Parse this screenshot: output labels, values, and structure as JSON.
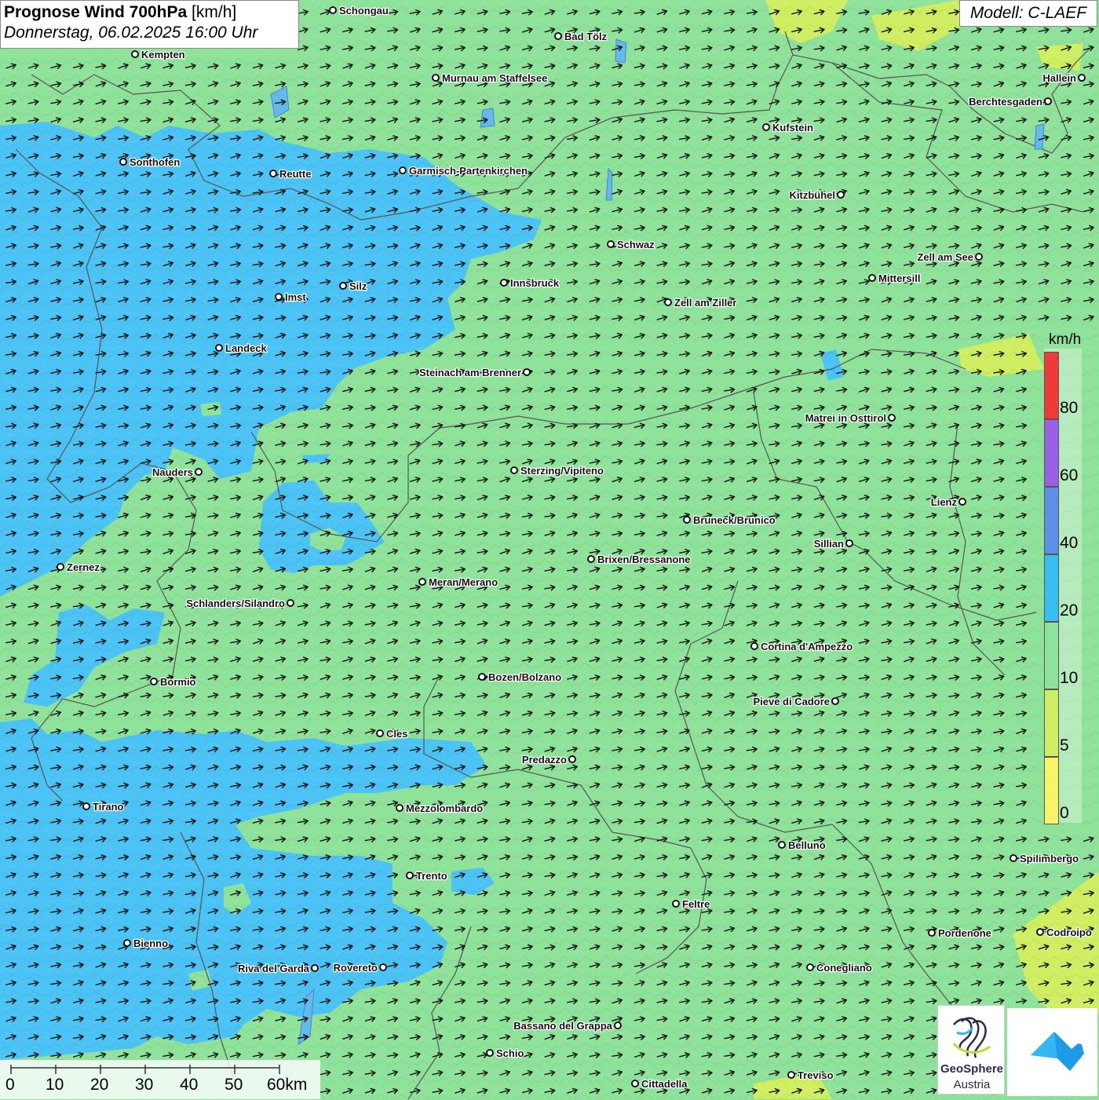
{
  "title": {
    "bold": "Prognose Wind 700hPa",
    "unit": " [km/h]",
    "date": "Donnerstag, 06.02.2025 16:00 Uhr"
  },
  "model": "Modell: C-LAEF",
  "legend": {
    "unit": "km/h",
    "labels": [
      "80",
      "60",
      "40",
      "20",
      "10",
      "5",
      "0"
    ],
    "colors": [
      "#f03a3a",
      "#9a60e6",
      "#5c8fe8",
      "#36bdf2",
      "#8fe29a",
      "#cfee62",
      "#f6f56a"
    ]
  },
  "scale": {
    "labels": [
      "0",
      "10",
      "20",
      "30",
      "40",
      "50",
      "60km"
    ]
  },
  "colors": {
    "calm_green": "#8fe29a",
    "light_blue": "#4cc3f5",
    "yellow_green": "#cfee62"
  },
  "cities": [
    {
      "name": "Schongau"
    },
    {
      "name": "Bad Tölz"
    },
    {
      "name": "Kempten"
    },
    {
      "name": "Murnau am Staffelsee"
    },
    {
      "name": "Hallein"
    },
    {
      "name": "Berchtesgaden"
    },
    {
      "name": "Kufstein"
    },
    {
      "name": "Sonthofen"
    },
    {
      "name": "Reutte"
    },
    {
      "name": "Garmisch-Partenkirchen"
    },
    {
      "name": "Kitzbühel"
    },
    {
      "name": "Schwaz"
    },
    {
      "name": "Zell am See"
    },
    {
      "name": "Mittersill"
    },
    {
      "name": "Innsbruck"
    },
    {
      "name": "Silz"
    },
    {
      "name": "Imst"
    },
    {
      "name": "Zell am Ziller"
    },
    {
      "name": "Landeck"
    },
    {
      "name": "Steinach am Brenner"
    },
    {
      "name": "Matrei in Osttirol"
    },
    {
      "name": "Nauders"
    },
    {
      "name": "Sterzing/Vipiteno"
    },
    {
      "name": "Lienz"
    },
    {
      "name": "Bruneck/Brunico"
    },
    {
      "name": "Sillian"
    },
    {
      "name": "Brixen/Bressanone"
    },
    {
      "name": "Zernez"
    },
    {
      "name": "Meran/Merano"
    },
    {
      "name": "Schlanders/Silandro"
    },
    {
      "name": "Cortina d'Ampezzo"
    },
    {
      "name": "Bozen/Bolzano"
    },
    {
      "name": "Bormio"
    },
    {
      "name": "Pieve di Cadore"
    },
    {
      "name": "Cles"
    },
    {
      "name": "Predazzo"
    },
    {
      "name": "Tirano"
    },
    {
      "name": "Mezzolombardo"
    },
    {
      "name": "Belluno"
    },
    {
      "name": "Spilimbergo"
    },
    {
      "name": "Trento"
    },
    {
      "name": "Feltre"
    },
    {
      "name": "Pordenone"
    },
    {
      "name": "Codroipo"
    },
    {
      "name": "Bienno"
    },
    {
      "name": "Riva del Garda"
    },
    {
      "name": "Rovereto"
    },
    {
      "name": "Conegliano"
    },
    {
      "name": "Bassano del Grappa"
    },
    {
      "name": "Schio"
    },
    {
      "name": "Treviso"
    },
    {
      "name": "Cittadella"
    }
  ],
  "logo": {
    "line1": "GeoSphere",
    "line2": "Austria"
  }
}
